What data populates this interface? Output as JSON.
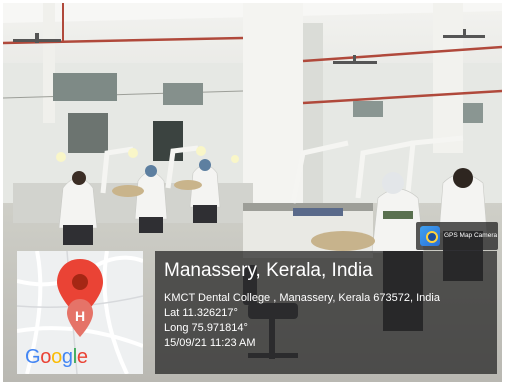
{
  "overlay": {
    "badge_app_name": "GPS Map Camera",
    "location_title": "Manassery, Kerala, India",
    "address": "KMCT Dental College , Manassery, Kerala 673572, India",
    "latitude": "Lat 11.326217°",
    "longitude": "Long 75.971814°",
    "timestamp": "15/09/21 11:23 AM"
  },
  "map": {
    "marker_letter": "H",
    "logo_text": [
      "G",
      "o",
      "o",
      "g",
      "l",
      "e"
    ],
    "logo_colors": [
      "#4285F4",
      "#EA4335",
      "#FBBC05",
      "#4285F4",
      "#34A853",
      "#EA4335"
    ]
  }
}
